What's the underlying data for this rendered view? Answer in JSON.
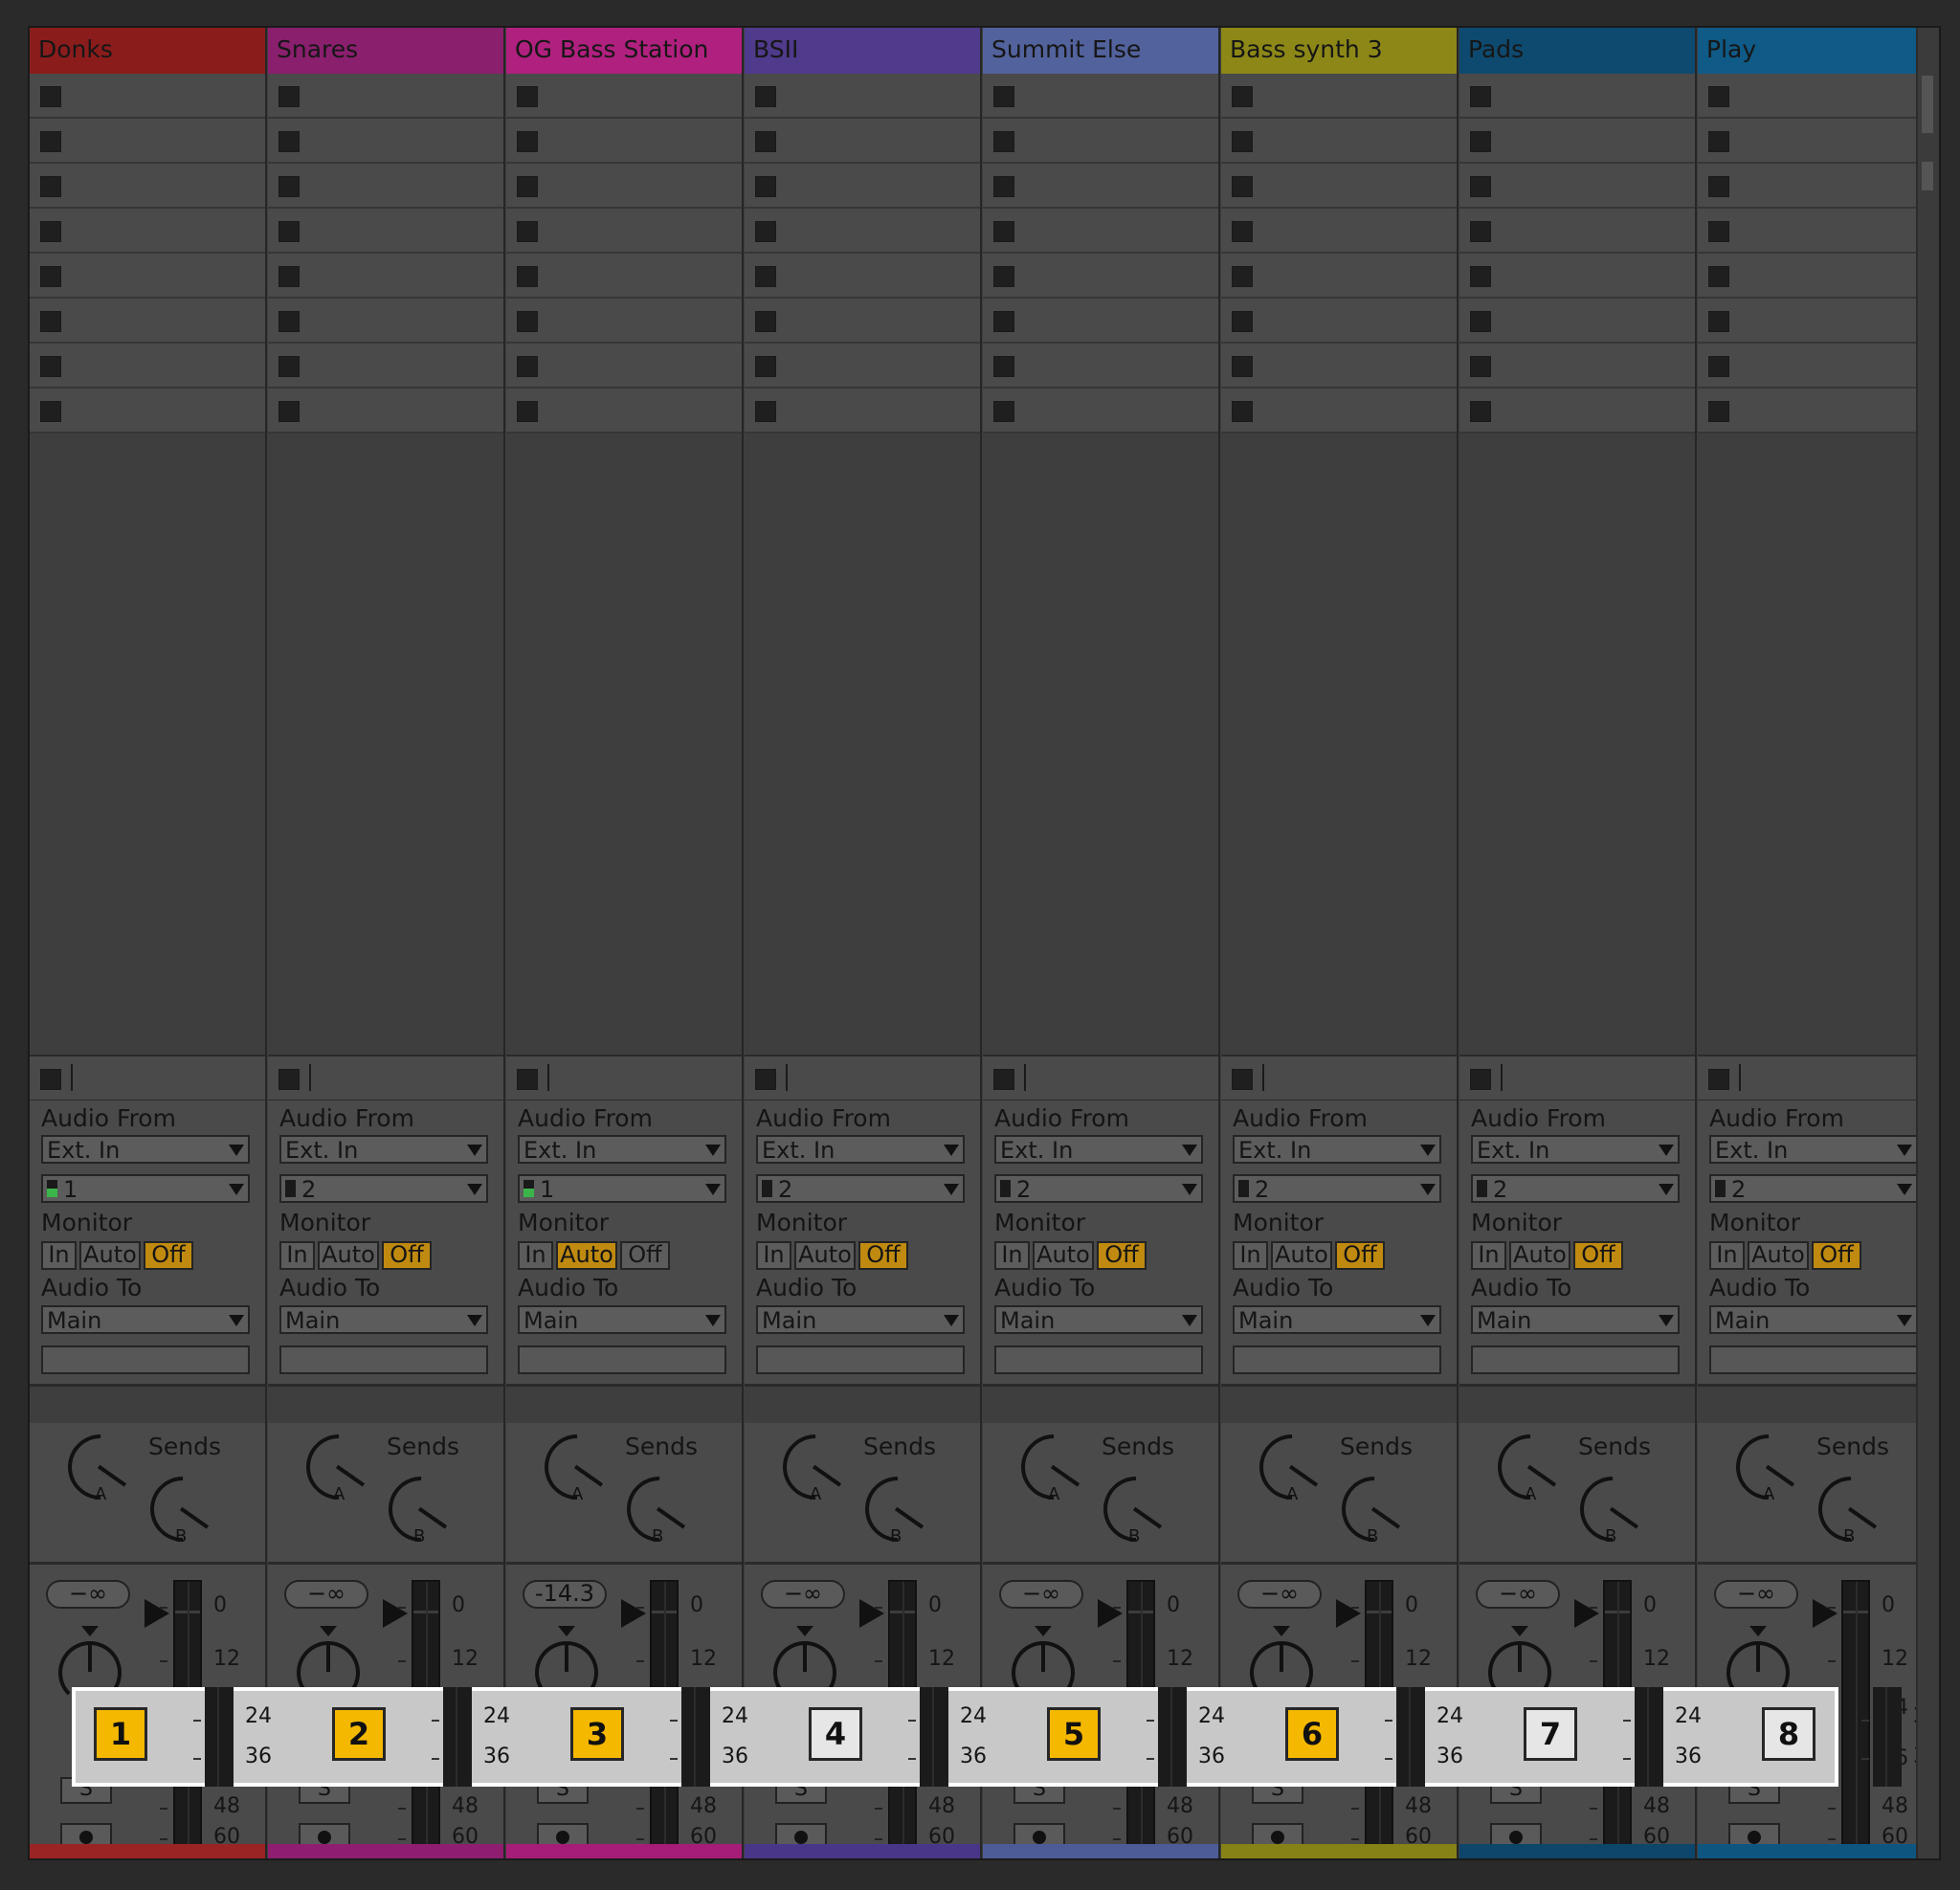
{
  "tracks": [
    {
      "name": "Donks",
      "color": "#8b1c1c",
      "strip": "#9a2323",
      "input_channel": "1",
      "chan_green": true,
      "monitor_active": "Off",
      "volume": "−∞",
      "track_num": "1",
      "num_on": true
    },
    {
      "name": "Snares",
      "color": "#8a1f6e",
      "strip": "#8f1e71",
      "input_channel": "2",
      "chan_green": false,
      "monitor_active": "Off",
      "volume": "−∞",
      "track_num": "2",
      "num_on": true
    },
    {
      "name": "OG Bass Station",
      "color": "#b0207e",
      "strip": "#a51d76",
      "input_channel": "1",
      "chan_green": true,
      "monitor_active": "Auto",
      "volume": "-14.3",
      "track_num": "3",
      "num_on": true
    },
    {
      "name": "BSII",
      "color": "#4f3a8c",
      "strip": "#4a3688",
      "input_channel": "2",
      "chan_green": false,
      "monitor_active": "Off",
      "volume": "−∞",
      "track_num": "4",
      "num_on": false
    },
    {
      "name": "Summit Else",
      "color": "#52629c",
      "strip": "#4d5b96",
      "input_channel": "2",
      "chan_green": false,
      "monitor_active": "Off",
      "volume": "−∞",
      "track_num": "5",
      "num_on": true
    },
    {
      "name": "Bass synth 3",
      "color": "#8c8717",
      "strip": "#878216",
      "input_channel": "2",
      "chan_green": false,
      "monitor_active": "Off",
      "volume": "−∞",
      "track_num": "6",
      "num_on": true
    },
    {
      "name": "Pads",
      "color": "#0e4a6f",
      "strip": "#0d466a",
      "input_channel": "2",
      "chan_green": false,
      "monitor_active": "Off",
      "volume": "−∞",
      "track_num": "7",
      "num_on": false
    },
    {
      "name": "Play",
      "color": "#0f5a86",
      "strip": "#0e5580",
      "input_channel": "2",
      "chan_green": false,
      "monitor_active": "Off",
      "volume": "−∞",
      "track_num": "8",
      "num_on": false
    }
  ],
  "labels": {
    "audio_from": "Audio From",
    "input_type": "Ext. In",
    "monitor": "Monitor",
    "mon_in": "In",
    "mon_auto": "Auto",
    "mon_off": "Off",
    "audio_to": "Audio To",
    "output": "Main",
    "sends": "Sends",
    "send_a": "A",
    "send_b": "B",
    "solo": "S"
  },
  "meter_scale": [
    "0",
    "12",
    "24",
    "36",
    "48",
    "60"
  ],
  "colors": {
    "active_button": "#f5b800",
    "monitor_active": "#c08a10",
    "background": "#3e3e3e"
  }
}
